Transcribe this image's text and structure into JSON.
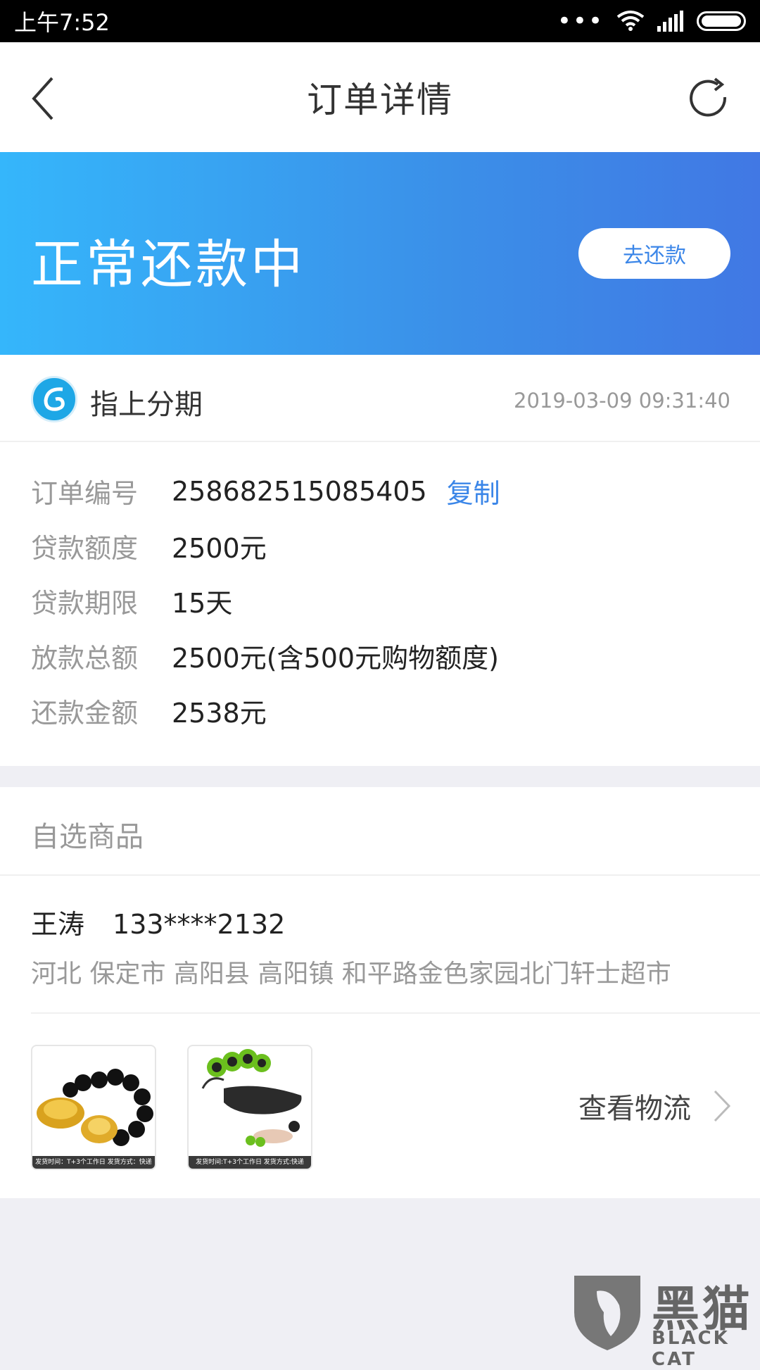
{
  "status_bar": {
    "time": "上午7:52",
    "dots": "•••"
  },
  "nav": {
    "title": "订单详情"
  },
  "banner": {
    "status": "正常还款中",
    "repay_button": "去还款"
  },
  "merchant": {
    "name": "指上分期",
    "datetime": "2019-03-09 09:31:40"
  },
  "details": {
    "order_no_label": "订单编号",
    "order_no": "258682515085405",
    "copy": "复制",
    "loan_amount_label": "贷款额度",
    "loan_amount": "2500元",
    "loan_term_label": "贷款期限",
    "loan_term": "15天",
    "disbursed_label": "放款总额",
    "disbursed": "2500元(含500元购物额度)",
    "repay_label": "还款金额",
    "repay_amount": "2538元"
  },
  "goods": {
    "title": "自选商品",
    "recipient_name": "王涛",
    "recipient_phone": "133****2132",
    "address": "河北 保定市 高阳县 高阳镇 和平路金色家园北门轩士超市",
    "items": [
      {
        "caption": "发货时间：T+3个工作日 发货方式：快递",
        "icon": "bracelet-product-image"
      },
      {
        "caption": "发货时间:T+3个工作日 发货方式:快递",
        "icon": "ab-roller-product-image"
      }
    ],
    "logistics": "查看物流"
  },
  "watermark": {
    "text": "黑猫",
    "sub": "BLACK CAT"
  },
  "colors": {
    "accent": "#3b86e8",
    "banner_start": "#35b6fb",
    "banner_end": "#4178e4"
  }
}
